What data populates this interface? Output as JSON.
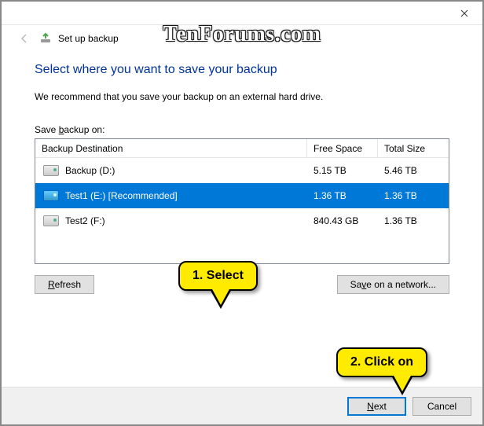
{
  "watermark": "TenForums.com",
  "window": {
    "back_icon": "←",
    "setup_icon_color": "#4fa64f",
    "title": "Set up backup"
  },
  "main": {
    "heading": "Select where you want to save your backup",
    "description": "We recommend that you save your backup on an external hard drive.",
    "save_label_pre": "Save ",
    "save_label_u": "b",
    "save_label_post": "ackup on:",
    "columns": {
      "dest": "Backup Destination",
      "free": "Free Space",
      "total": "Total Size"
    },
    "rows": [
      {
        "name": "Backup (D:)",
        "free": "5.15 TB",
        "total": "5.46 TB",
        "selected": false
      },
      {
        "name": "Test1 (E:) [Recommended]",
        "free": "1.36 TB",
        "total": "1.36 TB",
        "selected": true
      },
      {
        "name": "Test2 (F:)",
        "free": "840.43 GB",
        "total": "1.36 TB",
        "selected": false
      }
    ],
    "refresh_u": "R",
    "refresh_post": "efresh",
    "network_pre": "Sa",
    "network_u": "v",
    "network_post": "e on a network..."
  },
  "footer": {
    "next_u": "N",
    "next_post": "ext",
    "cancel": "Cancel"
  },
  "callouts": {
    "c1": "1. Select",
    "c2": "2. Click on"
  }
}
